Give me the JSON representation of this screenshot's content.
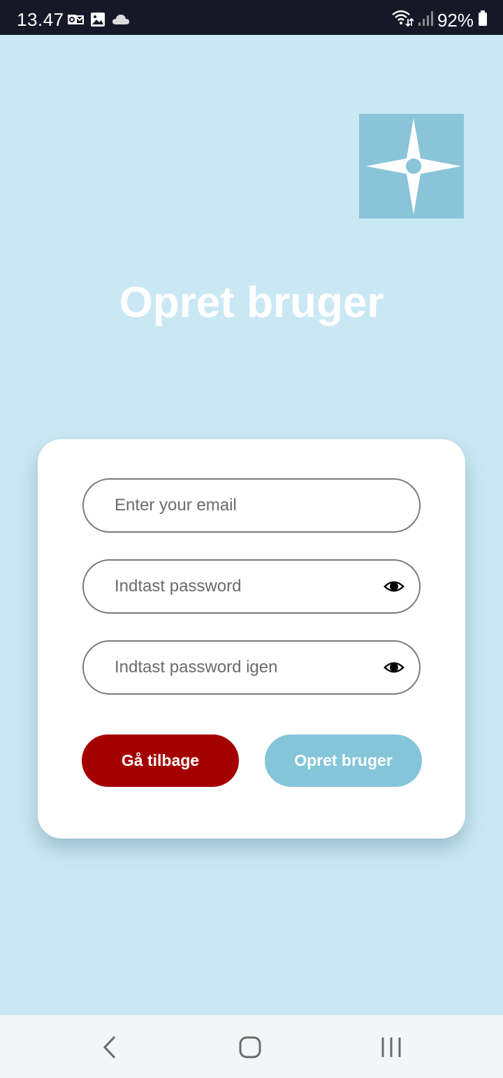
{
  "status_bar": {
    "time": "13.47",
    "battery": "92%",
    "left_icons": [
      "outlook-notification-icon",
      "gallery-notification-icon",
      "cloud-notification-icon"
    ],
    "right_icons": [
      "wifi-icon",
      "signal-icon",
      "battery-icon"
    ]
  },
  "header": {
    "title": "Opret bruger",
    "logo_icon": "compass-star-icon"
  },
  "form": {
    "email_placeholder": "Enter your email",
    "password_placeholder": "Indtast password",
    "password_repeat_placeholder": "Indtast password igen",
    "visibility_icon": "eye-icon",
    "back_label": "Gå tilbage",
    "create_label": "Opret bruger"
  },
  "nav_bar": {
    "icons": [
      "back-icon",
      "home-icon",
      "recent-apps-icon"
    ]
  },
  "colors": {
    "background": "#cae8f4",
    "status_bar": "#171827",
    "logo_background": "#8ac4d9",
    "back_button": "#a50000",
    "create_button": "#85c5da",
    "card": "#ffffff",
    "nav_bar": "#f4f5f7"
  }
}
